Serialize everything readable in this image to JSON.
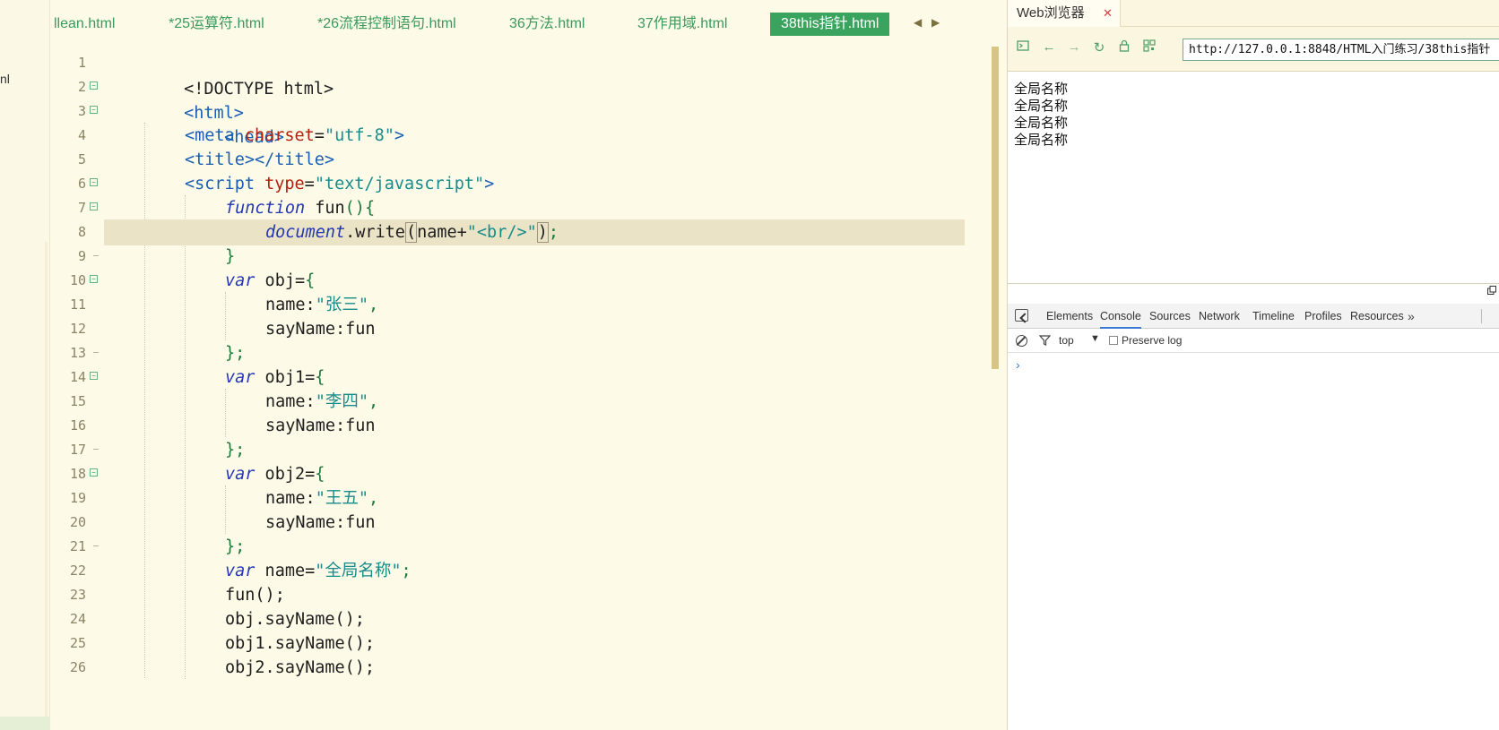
{
  "left_panel": {
    "fragment": "nl"
  },
  "editor": {
    "tabs": [
      {
        "label": "llean.html",
        "active": false
      },
      {
        "label": "*25运算符.html",
        "active": false
      },
      {
        "label": "*26流程控制语句.html",
        "active": false
      },
      {
        "label": "36方法.html",
        "active": false
      },
      {
        "label": "37作用域.html",
        "active": false
      },
      {
        "label": "38this指针.html",
        "active": true
      }
    ],
    "line_numbers": [
      "1",
      "2",
      "3",
      "4",
      "5",
      "6",
      "7",
      "8",
      "9",
      "10",
      "11",
      "12",
      "13",
      "14",
      "15",
      "16",
      "17",
      "18",
      "19",
      "20",
      "21",
      "22",
      "23",
      "24",
      "25",
      "26"
    ],
    "lines": [
      {
        "text": "<!DOCTYPE html>"
      },
      {
        "text": "<html>"
      },
      {
        "text": "<head>"
      },
      {
        "text": "<meta charset=\"utf-8\">"
      },
      {
        "text": "<title></title>"
      },
      {
        "text": "<script type=\"text/javascript\">"
      },
      {
        "text": "function fun(){"
      },
      {
        "text": "document.write(name+\"<br/>\");"
      },
      {
        "text": "}"
      },
      {
        "text": "var obj={"
      },
      {
        "text": "name:\"张三\","
      },
      {
        "text": "sayName:fun"
      },
      {
        "text": "};"
      },
      {
        "text": "var obj1={"
      },
      {
        "text": "name:\"李四\","
      },
      {
        "text": "sayName:fun"
      },
      {
        "text": "};"
      },
      {
        "text": "var obj2={"
      },
      {
        "text": "name:\"王五\","
      },
      {
        "text": "sayName:fun"
      },
      {
        "text": "};"
      },
      {
        "text": "var name=\"全局名称\";"
      },
      {
        "text": "fun();"
      },
      {
        "text": "obj.sayName();"
      },
      {
        "text": "obj1.sayName();"
      },
      {
        "text": "obj2.sayName();"
      }
    ],
    "tokens": {
      "doctype": "<!DOCTYPE html>",
      "html_open": "<html>",
      "head_open": "<head>",
      "meta_open": "<meta ",
      "meta_attr": "charset",
      "eq": "=",
      "meta_val": "\"utf-8\"",
      "tag_close": ">",
      "title_tags": "<title></title>",
      "script_open": "<script ",
      "script_attr": "type",
      "script_val": "\"text/javascript\"",
      "kw_function": "function",
      "fn_decl": " fun",
      "parens_brace": "(){",
      "doc_obj": "document",
      "dot_write": ".write",
      "lparen": "(",
      "name_plus": "name+",
      "br_str": "\"<br/>\"",
      "rparen": ")",
      "semi": ";",
      "rbrace": "}",
      "kw_var": "var",
      "obj_decl": " obj=",
      "obj1_decl": " obj1=",
      "obj2_decl": " obj2=",
      "lbrace": "{",
      "name_key": "name:",
      "val_zhangsan": "\"张三\"",
      "val_lisi": "\"李四\"",
      "val_wangwu": "\"王五\"",
      "comma": ",",
      "sayname_key": "sayName:",
      "fun_ref": "fun",
      "close_obj": "};",
      "name_decl": " name=",
      "val_global": "\"全局名称\"",
      "call_fun": "fun();",
      "call_obj": "obj.sayName();",
      "call_obj1": "obj1.sayName();",
      "call_obj2": "obj2.sayName();"
    }
  },
  "browser": {
    "tab_label": "Web浏览器",
    "tab_close": "✕",
    "url": "http://127.0.0.1:8848/HTML入门练习/38this指针",
    "output_lines": [
      "全局名称",
      "全局名称",
      "全局名称",
      "全局名称"
    ],
    "toolbar_icons": [
      "terminal-icon",
      "back-icon",
      "forward-icon",
      "refresh-icon",
      "lock-icon",
      "qrcode-icon"
    ]
  },
  "devtools": {
    "tabs": [
      "Elements",
      "Console",
      "Sources",
      "Network",
      "Timeline",
      "Profiles",
      "Resources"
    ],
    "active_tab": "Console",
    "more": "»",
    "context": "top",
    "context_arrow": "▼",
    "preserve_log": "Preserve log",
    "prompt": "›"
  },
  "colors": {
    "tag": "#1a5fb4",
    "attribute": "#b4200e",
    "string": "#188b8b",
    "keyword": "#2437b3",
    "tab_active_bg": "#3aa35e",
    "tab_text": "#3a9a5b",
    "editor_bg": "#fdfae8"
  }
}
